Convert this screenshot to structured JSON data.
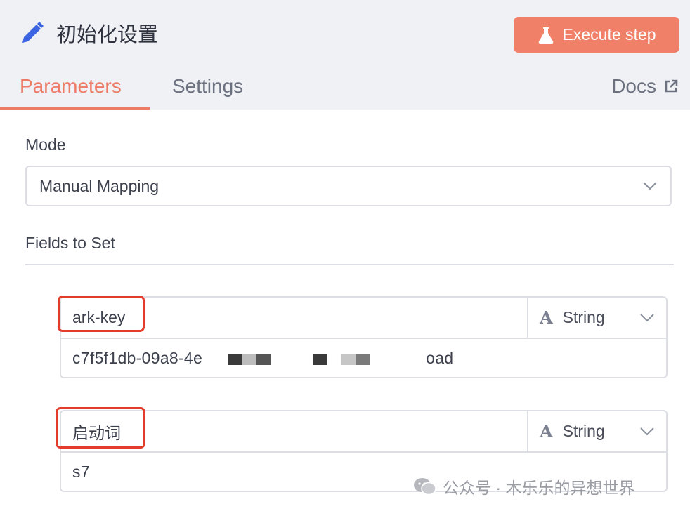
{
  "header": {
    "title": "初始化设置",
    "execute_label": "Execute step",
    "tabs": [
      {
        "label": "Parameters",
        "active": true
      },
      {
        "label": "Settings",
        "active": false
      }
    ],
    "docs_label": "Docs"
  },
  "mode": {
    "label": "Mode",
    "value": "Manual Mapping"
  },
  "fields_section": {
    "label": "Fields to Set",
    "fields": [
      {
        "name": "ark-key",
        "type": "String",
        "value": "c7f5f1db-09a8-4e",
        "value_tail": "oad"
      },
      {
        "name": "启动词",
        "type": "String",
        "value": "s7"
      }
    ]
  },
  "watermark": "公众号 · 木乐乐的异想世界",
  "colors": {
    "accent": "#ee7b65",
    "button": "#f08068",
    "highlight": "#e33c2a",
    "header_bg": "#f0f1f5"
  },
  "icons": [
    "pencil-icon",
    "flask-icon",
    "external-link-icon",
    "chevron-down-icon",
    "type-a-icon",
    "wechat-icon"
  ]
}
